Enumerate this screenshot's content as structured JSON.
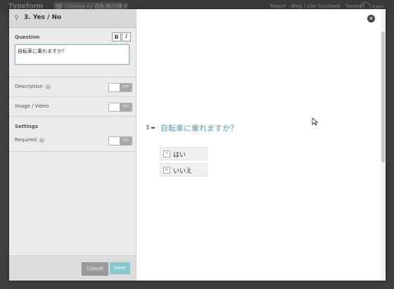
{
  "background": {
    "logo": "Typeform",
    "tab_label": "chitose to 自転車の練習",
    "links": "Report · Blog | Like facebook · Support",
    "user": "Kato"
  },
  "editor": {
    "header_title": "3. Yes / No",
    "question_label": "Question",
    "bold_label": "B",
    "italic_label": "I",
    "question_value": "自転車に乗れますか？",
    "description_label": "Description",
    "image_video_label": "Image / Video",
    "settings_label": "Settings",
    "required_label": "Required",
    "toggle_off_text": "OFF",
    "help_icon": "?",
    "cancel_label": "Cancel",
    "save_label": "Save"
  },
  "preview": {
    "close_icon": "✕",
    "question_number": "3",
    "arrow_icon": "➡",
    "question_text": "自転車に乗れますか？",
    "choices": [
      {
        "key": "Y",
        "label": "はい"
      },
      {
        "key": "N",
        "label": "いいえ"
      }
    ]
  },
  "colors": {
    "accent": "#4f9eb2",
    "save_button": "#8cc5ce",
    "cancel_button": "#9b9b9b",
    "input_border": "#7fb3bd"
  }
}
